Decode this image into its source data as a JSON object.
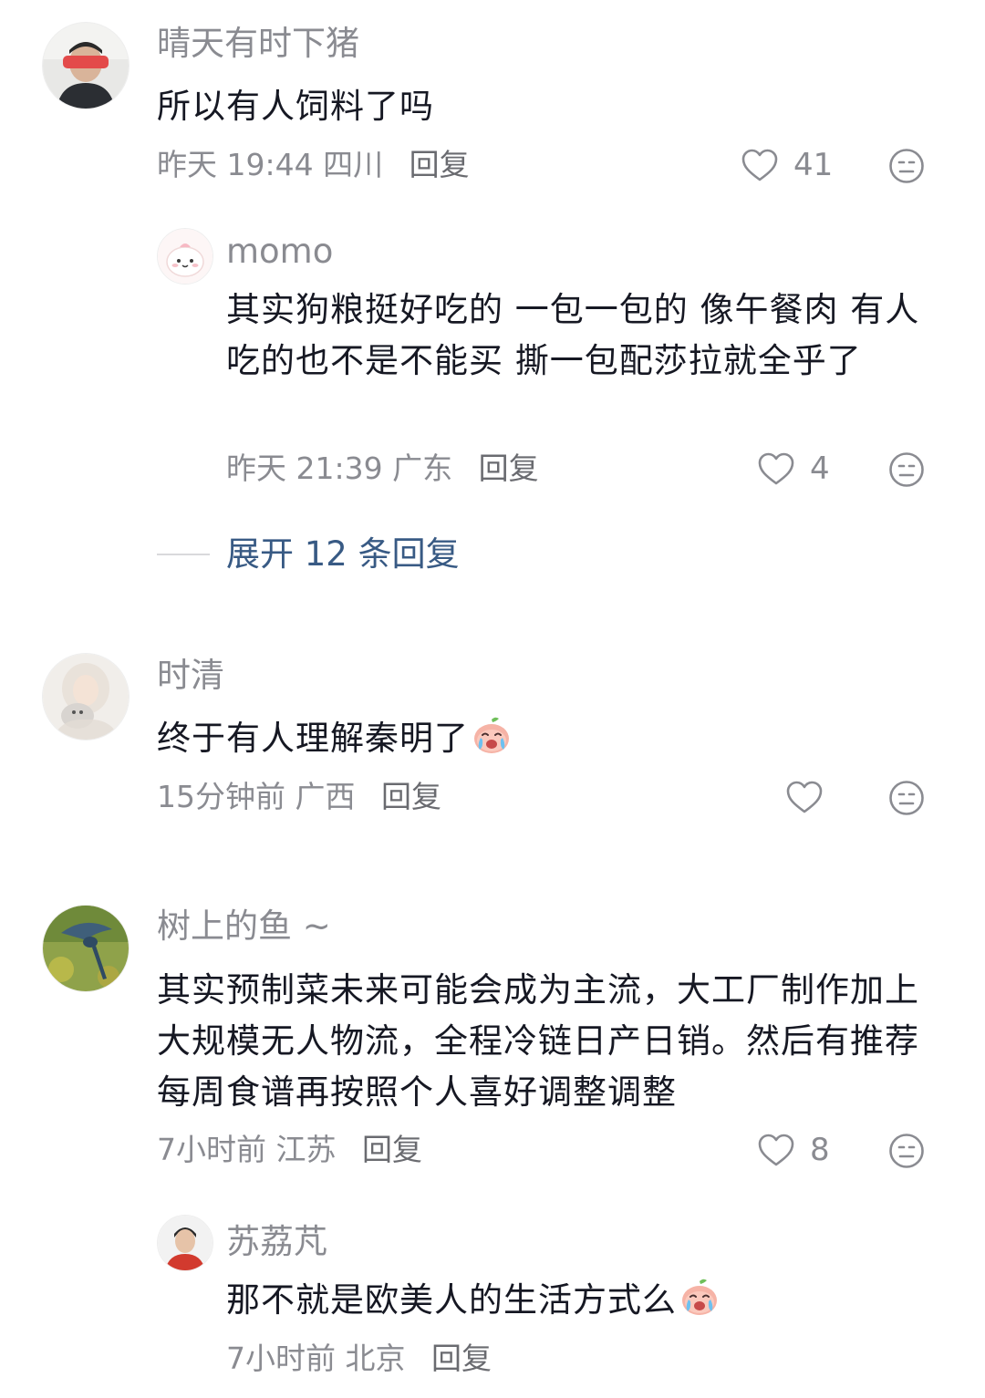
{
  "comments": [
    {
      "username": "晴天有时下猪",
      "content": "所以有人饲料了吗",
      "time": "昨天 19:44",
      "location": "四川",
      "reply_label": "回复",
      "likes": "41",
      "avatar_icon": "user-avatar-photo"
    },
    {
      "username": "momo",
      "content": "其实狗粮挺好吃的 一包一包的 像午餐肉 有人吃的也不是不能买 撕一包配莎拉就全乎了",
      "time": "昨天 21:39",
      "location": "广东",
      "reply_label": "回复",
      "likes": "4",
      "avatar_icon": "cartoon-bun-avatar"
    },
    {
      "username": "时清",
      "content": "终于有人理解秦明了",
      "time": "15分钟前",
      "location": "广西",
      "reply_label": "回复",
      "likes": "",
      "avatar_icon": "girl-with-cat-avatar"
    },
    {
      "username": "树上的鱼 ~",
      "content": "其实预制菜未来可能会成为主流，大工厂制作加上大规模无人物流，全程冷链日产日销。然后有推荐每周食谱再按照个人喜好调整调整",
      "time": "7小时前",
      "location": "江苏",
      "reply_label": "回复",
      "likes": "8",
      "avatar_icon": "bird-photo-avatar"
    },
    {
      "username": "苏荔芃",
      "content": "那不就是欧美人的生活方式么",
      "time": "7小时前",
      "location": "北京",
      "reply_label": "回复",
      "likes": "",
      "avatar_icon": "man-photo-avatar"
    }
  ],
  "expand_replies": "展开 12 条回复",
  "icons": {
    "like": "heart-outline-icon",
    "dislike": "meh-face-icon",
    "emoji": "crying-peach-emoji"
  },
  "colors": {
    "text": "#161823",
    "secondary": "#8a8b91",
    "link": "#385a84"
  }
}
